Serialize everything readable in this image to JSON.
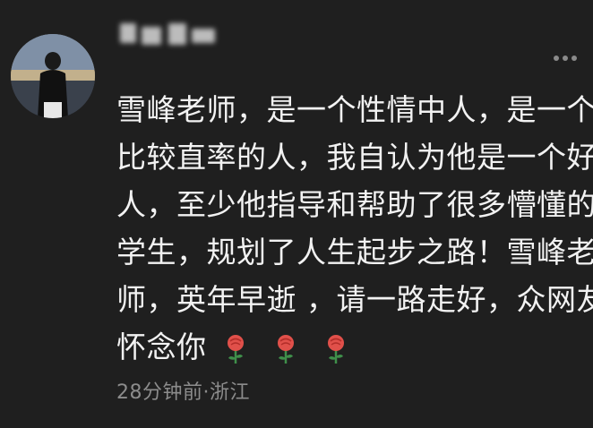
{
  "comment": {
    "lines": [
      "雪峰老师，是一个性情中人，是一个",
      "比较直率的人，我自认为他是一个好",
      "人，至少他指导和帮助了很多懵懂的",
      "学生，规划了人生起步之路！雪峰老",
      "师，英年早逝 ，请一路走好，众网友"
    ],
    "last_line": "怀念你",
    "emoji": [
      "rose-icon",
      "rose-icon",
      "rose-icon"
    ],
    "meta": "28分钟前·浙江"
  },
  "colors": {
    "background": "#1f1f1f",
    "text": "#f2f2f2",
    "meta": "#8c8c8c",
    "rose": "#e0504a"
  }
}
